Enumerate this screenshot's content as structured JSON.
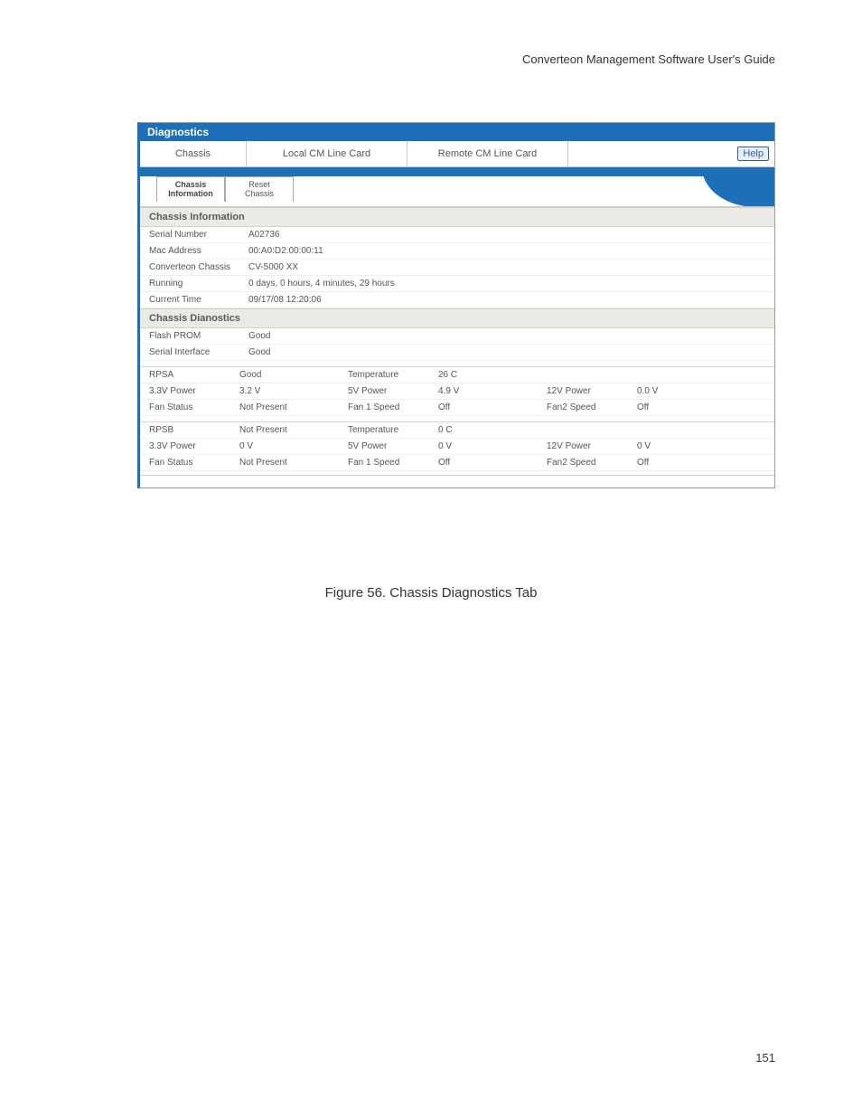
{
  "doc_title": "Converteon Management Software User's Guide",
  "page_num": "151",
  "caption": "Figure 56. Chassis Diagnostics Tab",
  "app": {
    "title": "Diagnostics",
    "tabs": [
      "Chassis",
      "Local CM Line Card",
      "Remote CM Line Card"
    ],
    "help": "Help",
    "subtabs": [
      "Chassis\nInformation",
      "Reset\nChassis"
    ],
    "section1": "Chassis Information",
    "info": {
      "serial_l": "Serial Number",
      "serial_v": "A02736",
      "mac_l": "Mac Address",
      "mac_v": "00:A0:D2:00:00:11",
      "chassis_l": "Converteon Chassis",
      "chassis_v": "CV-5000 XX",
      "running_l": "Running",
      "running_v": "0 days, 0 hours, 4 minutes, 29 hours",
      "time_l": "Current Time",
      "time_v": "09/17/08 12:20:06"
    },
    "section2": "Chassis Dianostics",
    "diag": {
      "flash_l": "Flash PROM",
      "flash_v": "Good",
      "si_l": "Serial Interface",
      "si_v": "Good"
    },
    "rpsa": {
      "r1": {
        "c1": "RPSA",
        "c2": "Good",
        "c3": "Temperature",
        "c4": "26 C",
        "c5": "",
        "c6": ""
      },
      "r2": {
        "c1": "3.3V Power",
        "c2": "3.2 V",
        "c3": "5V Power",
        "c4": "4.9 V",
        "c5": "12V Power",
        "c6": "0.0 V"
      },
      "r3": {
        "c1": "Fan Status",
        "c2": "Not Present",
        "c3": "Fan 1 Speed",
        "c4": "Off",
        "c5": "Fan2 Speed",
        "c6": "Off"
      }
    },
    "rpsb": {
      "r1": {
        "c1": "RPSB",
        "c2": "Not Present",
        "c3": "Temperature",
        "c4": "0 C",
        "c5": "",
        "c6": ""
      },
      "r2": {
        "c1": "3.3V Power",
        "c2": "0 V",
        "c3": "5V Power",
        "c4": "0 V",
        "c5": "12V Power",
        "c6": "0 V"
      },
      "r3": {
        "c1": "Fan Status",
        "c2": "Not Present",
        "c3": "Fan 1 Speed",
        "c4": "Off",
        "c5": "Fan2 Speed",
        "c6": "Off"
      }
    }
  }
}
